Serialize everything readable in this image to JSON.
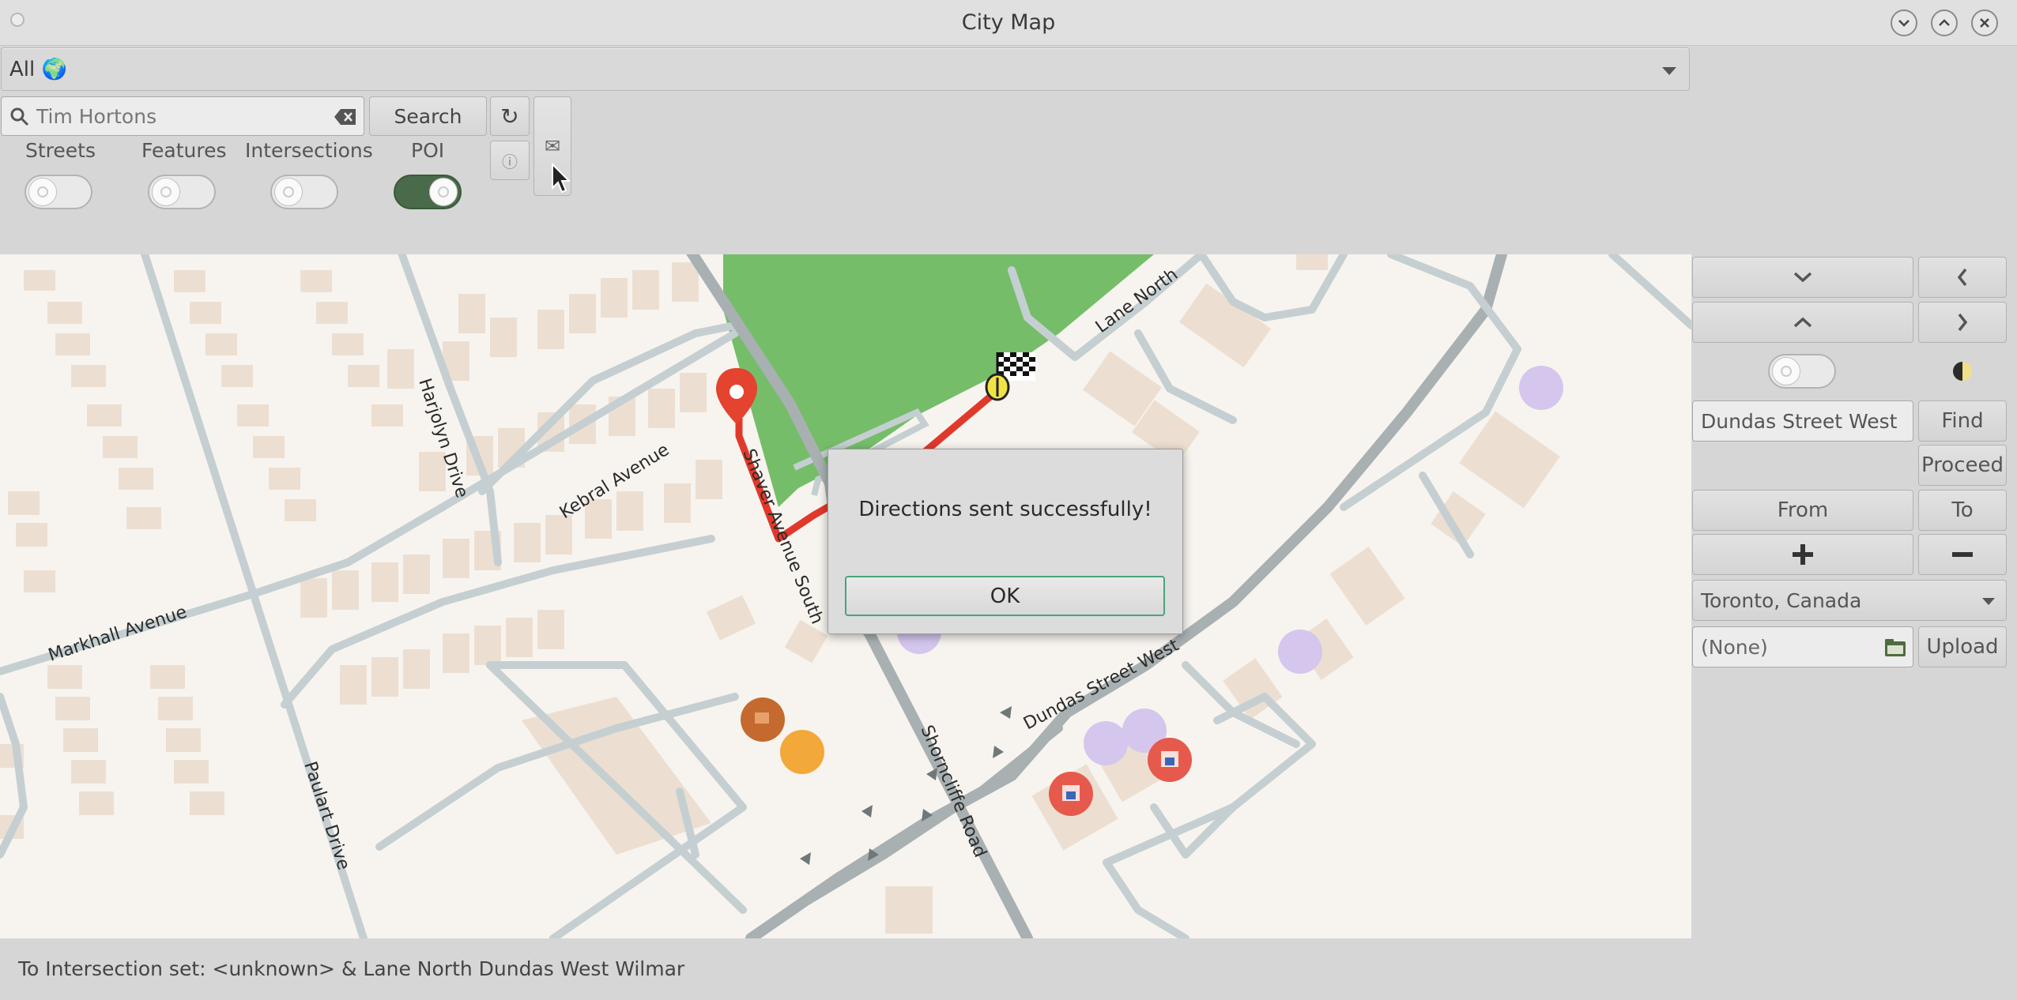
{
  "window": {
    "title": "City Map"
  },
  "filter": {
    "selected": "All 🌍"
  },
  "toolbar": {
    "search_value": "Tim Hortons",
    "search_button": "Search",
    "refresh_glyph": "↻",
    "info_glyph": "ⓘ",
    "mail_glyph": "✉"
  },
  "layers": [
    {
      "label": "Streets",
      "on": false
    },
    {
      "label": "Features",
      "on": false
    },
    {
      "label": "Intersections",
      "on": false
    },
    {
      "label": "POI",
      "on": true
    }
  ],
  "map": {
    "streets": [
      "Harjolyn Drive",
      "Kebral Avenue",
      "Markhall Avenue",
      "Paulart Drive",
      "Shaver Avenue South",
      "Shorncliffe Road",
      "Dundas Street West",
      "Lane North"
    ],
    "colors": {
      "park": "#76bd6a",
      "route": "#e0392b",
      "road": "#c5cfd1",
      "building": "#ecdfd1",
      "poi_purple": "#d5c6ee",
      "poi_red": "#e55a4c",
      "poi_orange": "#f3a83a",
      "poi_brown": "#c46a2f"
    },
    "icons": [
      "start-pin-icon",
      "finish-flag-icon",
      "cafe-icon",
      "shop-icon"
    ]
  },
  "dialog": {
    "message": "Directions sent successfully!",
    "ok_label": "OK"
  },
  "right_panel": {
    "down_glyph": "⌄",
    "left_glyph": "‹",
    "up_glyph": "⌃",
    "right_glyph": "›",
    "find_value": "Dundas Street West",
    "find_label": "Find",
    "proceed_label": "Proceed",
    "from_label": "From",
    "to_label": "To",
    "zoom_in_glyph": "+",
    "zoom_out_glyph": "−",
    "city_selected": "Toronto, Canada",
    "file_value": "(None)",
    "upload_label": "Upload"
  },
  "status": {
    "text": "To Intersection set: <unknown> & Lane North Dundas West Wilmar"
  }
}
